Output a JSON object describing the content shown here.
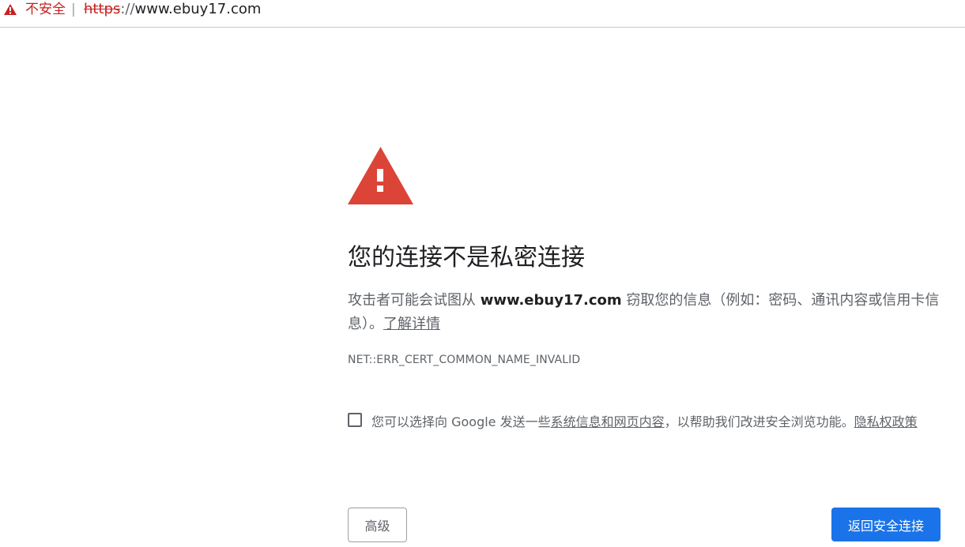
{
  "addressbar": {
    "security_label": "不安全",
    "separator": "|",
    "url_scheme": "https",
    "url_slashes": "://",
    "url_host": "www.ebuy17.com"
  },
  "interstitial": {
    "heading": "您的连接不是私密连接",
    "desc_before": "攻击者可能会试图从 ",
    "desc_host": "www.ebuy17.com",
    "desc_after": " 窃取您的信息（例如：密码、通讯内容或信用卡信息）。",
    "learn_more": "了解详情",
    "error_code": "NET::ERR_CERT_COMMON_NAME_INVALID",
    "optin_before": "您可以选择向 Google 发送一些",
    "optin_link": "系统信息和网页内容",
    "optin_after": "，以帮助我们改进安全浏览功能。",
    "privacy_link": "隐私权政策",
    "advanced_button": "高级",
    "back_button": "返回安全连接"
  },
  "colors": {
    "warning_red": "#db4437",
    "insecure_red": "#c5221f",
    "primary_blue": "#1a73e8",
    "text_gray": "#5f6368"
  },
  "icons": {
    "address_warning": "warning-triangle-icon",
    "main_warning": "warning-triangle-icon"
  }
}
